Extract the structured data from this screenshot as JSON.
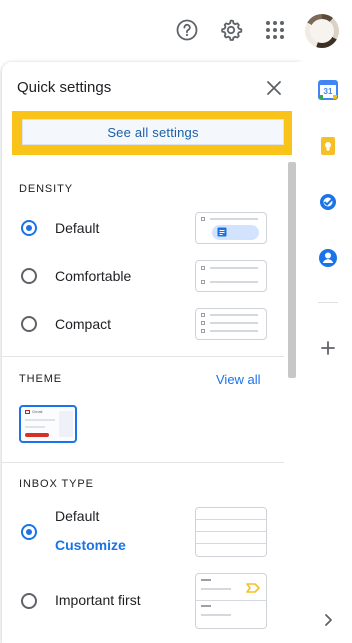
{
  "header": {
    "help_icon": "help-circle-icon",
    "settings_icon": "gear-icon",
    "apps_icon": "apps-grid-icon",
    "avatar_icon": "avatar"
  },
  "quick_settings": {
    "title": "Quick settings",
    "close_icon": "close-icon",
    "see_all_label": "See all settings",
    "highlight_color": "#f9c31a",
    "density": {
      "heading": "DENSITY",
      "options": [
        {
          "label": "Default",
          "selected": true
        },
        {
          "label": "Comfortable",
          "selected": false
        },
        {
          "label": "Compact",
          "selected": false
        }
      ]
    },
    "theme": {
      "heading": "THEME",
      "view_all_label": "View all",
      "thumb_text": "Gmail"
    },
    "inbox_type": {
      "heading": "INBOX TYPE",
      "options": [
        {
          "label": "Default",
          "selected": true,
          "link": "Customize"
        },
        {
          "label": "Important first",
          "selected": false
        }
      ]
    }
  },
  "side_rail": {
    "calendar_label": "31",
    "icons": [
      "calendar-icon",
      "keep-icon",
      "tasks-icon",
      "contacts-icon",
      "add-icon",
      "chevron-right-icon"
    ]
  },
  "colors": {
    "accent": "#1a73e8",
    "link": "#1a5fa8",
    "keep_yellow": "#f6bf26"
  }
}
